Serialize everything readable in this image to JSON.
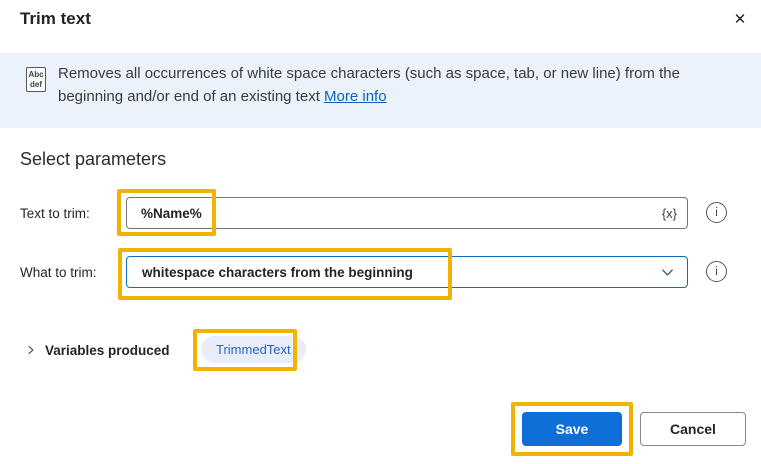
{
  "dialog": {
    "title": "Trim text"
  },
  "icons": {
    "close": "✕",
    "info": "i",
    "action_icon_line1": "Abc",
    "action_icon_line2": "def"
  },
  "banner": {
    "description": "Removes all occurrences of white space characters (such as space, tab, or new line) from the beginning and/or end of an existing text",
    "more_info_label": "More info"
  },
  "parameters": {
    "heading": "Select parameters",
    "text_to_trim": {
      "label": "Text to trim:",
      "value": "%Name%",
      "variable_picker_label": "{x}"
    },
    "what_to_trim": {
      "label": "What to trim:",
      "value": "whitespace characters from the beginning"
    }
  },
  "variables_produced": {
    "label": "Variables produced",
    "variable_name": "TrimmedText"
  },
  "footer": {
    "save_label": "Save",
    "cancel_label": "Cancel"
  },
  "colors": {
    "accent_blue": "#0E6FD8",
    "highlight_yellow": "#F0B400",
    "banner_bg": "#EBF2FB",
    "link_blue": "#1160B7",
    "dropdown_border": "#0F6CBD",
    "pill_bg": "#E9EDF9",
    "pill_text": "#2265C4"
  }
}
